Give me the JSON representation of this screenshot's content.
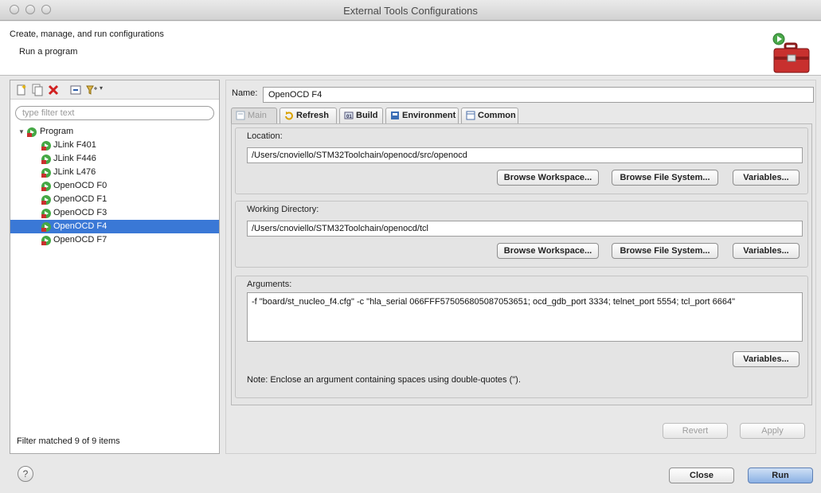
{
  "window": {
    "title": "External Tools Configurations"
  },
  "header": {
    "title": "Create, manage, and run configurations",
    "subtitle": "Run a program"
  },
  "left": {
    "filter_placeholder": "type filter text",
    "tree": {
      "root": "Program",
      "items": [
        "JLink F401",
        "JLink F446",
        "JLink L476",
        "OpenOCD F0",
        "OpenOCD F1",
        "OpenOCD F3",
        "OpenOCD F4",
        "OpenOCD F7"
      ],
      "selected": "OpenOCD F4"
    },
    "footer": "Filter matched 9 of 9 items"
  },
  "right": {
    "name_label": "Name:",
    "name_value": "OpenOCD F4",
    "tabs": [
      "Main",
      "Refresh",
      "Build",
      "Environment",
      "Common"
    ],
    "location": {
      "label": "Location:",
      "value": "/Users/cnoviello/STM32Toolchain/openocd/src/openocd",
      "browse_workspace": "Browse Workspace...",
      "browse_fs": "Browse File System...",
      "variables": "Variables..."
    },
    "working_dir": {
      "label": "Working Directory:",
      "value": "/Users/cnoviello/STM32Toolchain/openocd/tcl",
      "browse_workspace": "Browse Workspace...",
      "browse_fs": "Browse File System...",
      "variables": "Variables..."
    },
    "arguments": {
      "label": "Arguments:",
      "value": "-f \"board/st_nucleo_f4.cfg\" -c \"hla_serial 066FFF575056805087053651; ocd_gdb_port 3334; telnet_port 5554; tcl_port 6664\"",
      "variables": "Variables...",
      "note": "Note: Enclose an argument containing spaces using double-quotes (\")."
    },
    "revert": "Revert",
    "apply": "Apply"
  },
  "footer": {
    "close": "Close",
    "run": "Run",
    "help": "?"
  },
  "colors": {
    "selection": "#3a78d6",
    "run_button": "#8ab0e4"
  }
}
